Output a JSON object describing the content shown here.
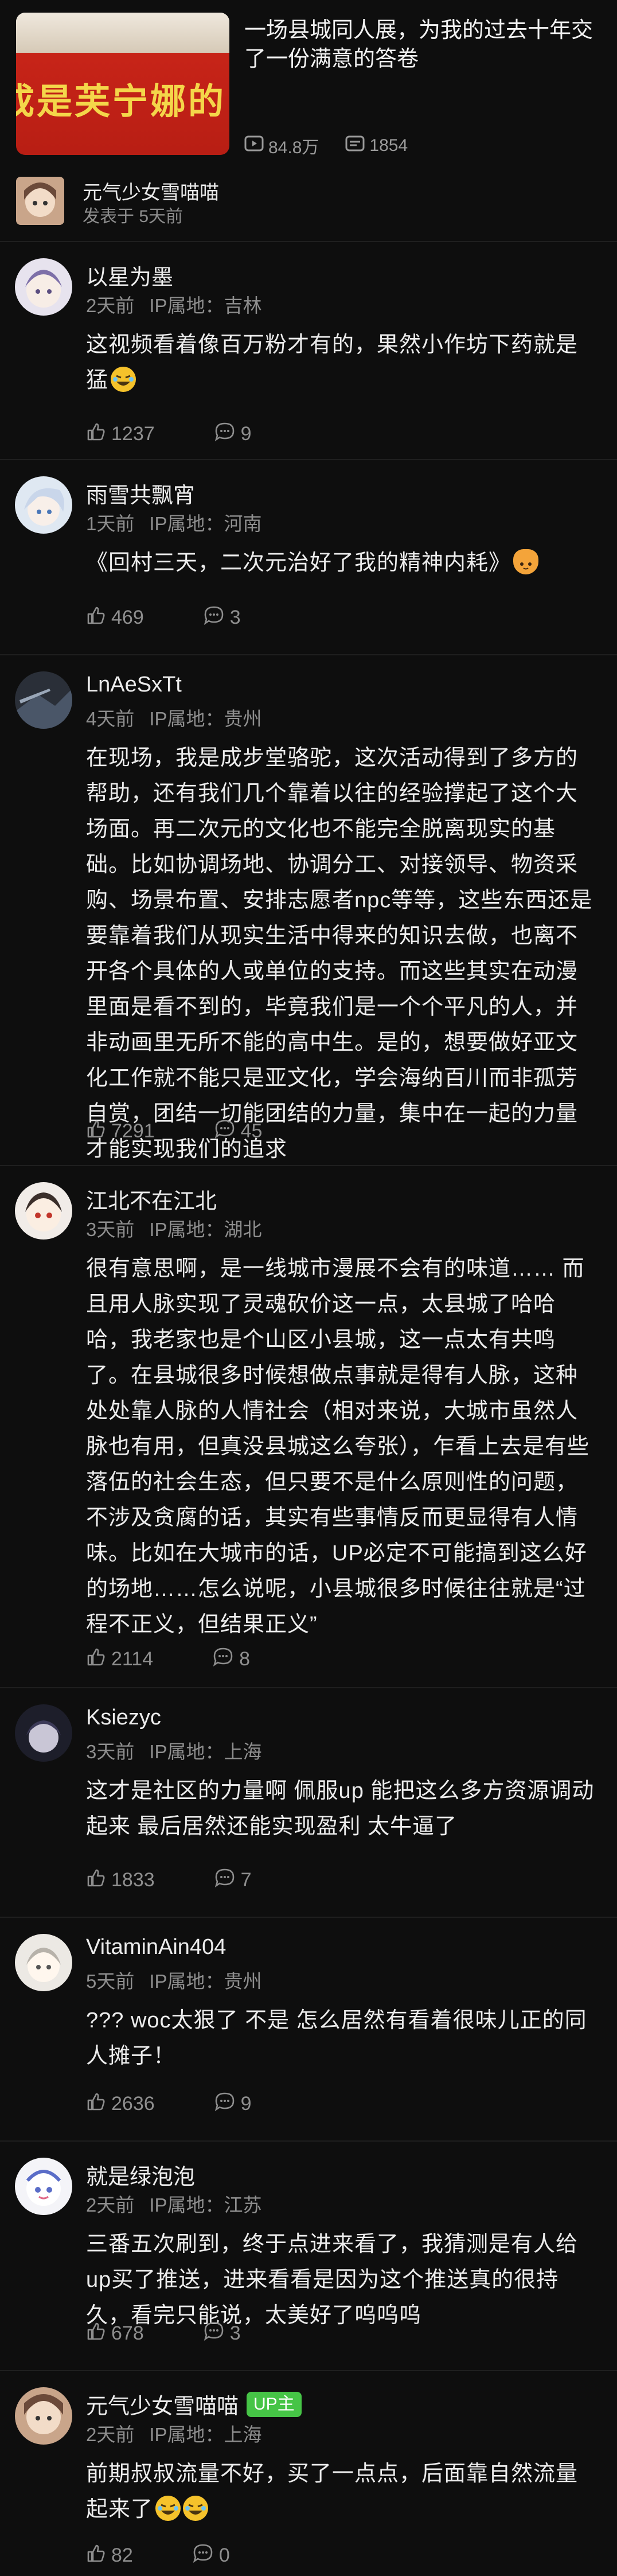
{
  "video": {
    "title": "一场县城同人展，为我的过去十年交了一份满意的答卷",
    "thumbnail_text": "成是芙宁娜的",
    "views": "84.8万",
    "comments": "1854"
  },
  "author": {
    "name": "元气少女雪喵喵",
    "posted": "发表于 5天前"
  },
  "comments": [
    {
      "name": "以星为墨",
      "time": "2天前",
      "ip": "IP属地：吉林",
      "text": "这视频看着像百万粉才有的，果然小作坊下药就是猛",
      "emoji": "laugh",
      "likes": "1237",
      "replies": "9"
    },
    {
      "name": "雨雪共飘宵",
      "time": "1天前",
      "ip": "IP属地：河南",
      "text": "《回村三天，二次元治好了我的精神内耗》",
      "emoji": "cat",
      "likes": "469",
      "replies": "3"
    },
    {
      "name": "LnAeSxTt",
      "time": "4天前",
      "ip": "IP属地：贵州",
      "text": "在现场，我是成步堂骆驼，这次活动得到了多方的帮助，还有我们几个靠着以往的经验撑起了这个大场面。再二次元的文化也不能完全脱离现实的基础。比如协调场地、协调分工、对接领导、物资采购、场景布置、安排志愿者npc等等，这些东西还是要靠着我们从现实生活中得来的知识去做，也离不开各个具体的人或单位的支持。而这些其实在动漫里面是看不到的，毕竟我们是一个个平凡的人，并非动画里无所不能的高中生。是的，想要做好亚文化工作就不能只是亚文化，学会海纳百川而非孤芳自赏，团结一切能团结的力量，集中在一起的力量才能实现我们的追求",
      "emoji": "",
      "likes": "7291",
      "replies": "45"
    },
    {
      "name": "江北不在江北",
      "time": "3天前",
      "ip": "IP属地：湖北",
      "text": "很有意思啊，是一线城市漫展不会有的味道…… 而且用人脉实现了灵魂砍价这一点，太县城了哈哈哈，我老家也是个山区小县城，这一点太有共鸣了。在县城很多时候想做点事就是得有人脉，这种处处靠人脉的人情社会（相对来说，大城市虽然人脉也有用，但真没县城这么夸张），乍看上去是有些落伍的社会生态，但只要不是什么原则性的问题，不涉及贪腐的话，其实有些事情反而更显得有人情味。比如在大城市的话，UP必定不可能搞到这么好的场地……怎么说呢，小县城很多时候往往就是“过程不正义，但结果正义”",
      "emoji": "",
      "likes": "2114",
      "replies": "8"
    },
    {
      "name": "Ksiezyc",
      "time": "3天前",
      "ip": "IP属地：上海",
      "text": "这才是社区的力量啊 佩服up 能把这么多方资源调动起来 最后居然还能实现盈利 太牛逼了",
      "emoji": "",
      "likes": "1833",
      "replies": "7"
    },
    {
      "name": "VitaminAin404",
      "time": "5天前",
      "ip": "IP属地：贵州",
      "text": "??? woc太狠了 不是 怎么居然有看着很味儿正的同人摊子！",
      "emoji": "",
      "likes": "2636",
      "replies": "9"
    },
    {
      "name": "就是绿泡泡",
      "time": "2天前",
      "ip": "IP属地：江苏",
      "text": "三番五次刷到，终于点进来看了，我猜测是有人给up买了推送，进来看看是因为这个推送真的很持久，看完只能说，太美好了呜呜呜",
      "emoji": "",
      "likes": "678",
      "replies": "3"
    },
    {
      "name": "元气少女雪喵喵",
      "badge": "UP主",
      "time": "2天前",
      "ip": "IP属地：上海",
      "text": "前期叔叔流量不好，买了一点点，后面靠自然流量起来了",
      "emoji": "laugh2",
      "likes": "82",
      "replies": "0"
    }
  ]
}
